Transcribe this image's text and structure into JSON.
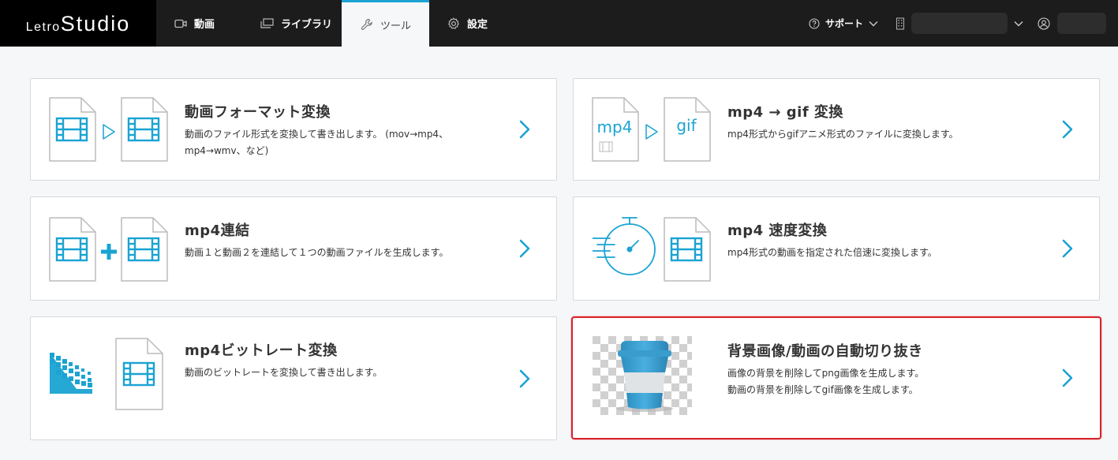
{
  "header": {
    "logo_part1": "Letro",
    "logo_part2": "Studio",
    "nav": [
      {
        "label": "動画",
        "icon": "video-camera-icon"
      },
      {
        "label": "ライブラリ",
        "icon": "library-icon"
      },
      {
        "label": "ツール",
        "icon": "wrench-icon",
        "active": true
      },
      {
        "label": "設定",
        "icon": "gear-icon"
      }
    ],
    "support_label": "サポート",
    "org_name": "",
    "user_name": ""
  },
  "colors": {
    "accent": "#1aa3d3",
    "header_bg": "#1c1c1c",
    "selection_border": "#d9232b"
  },
  "tools": [
    {
      "id": "format-convert",
      "title": "動画フォーマット変換",
      "desc_lines": [
        "動画のファイル形式を変換して書き出します。 (mov→mp4、",
        "mp4→wmv、など)"
      ]
    },
    {
      "id": "mp4-to-gif",
      "title": "mp4 → gif 変換",
      "desc_lines": [
        "mp4形式からgifアニメ形式のファイルに変換します。"
      ],
      "illus_text_from": "mp4",
      "illus_text_to": "gif"
    },
    {
      "id": "mp4-concat",
      "title": "mp4連結",
      "desc_lines": [
        "動画１と動画２を連結して１つの動画ファイルを生成します。"
      ]
    },
    {
      "id": "mp4-speed",
      "title": "mp4 速度変換",
      "desc_lines": [
        "mp4形式の動画を指定された倍速に変換します。"
      ]
    },
    {
      "id": "mp4-bitrate",
      "title": "mp4ビットレート変換",
      "desc_lines": [
        "動画のビットレートを変換して書き出します。"
      ]
    },
    {
      "id": "bg-removal",
      "title": "背景画像/動画の自動切り抜き",
      "desc_lines": [
        "画像の背景を削除してpng画像を生成します。",
        "動画の背景を削除してgif画像を生成します。"
      ],
      "selected": true
    }
  ]
}
